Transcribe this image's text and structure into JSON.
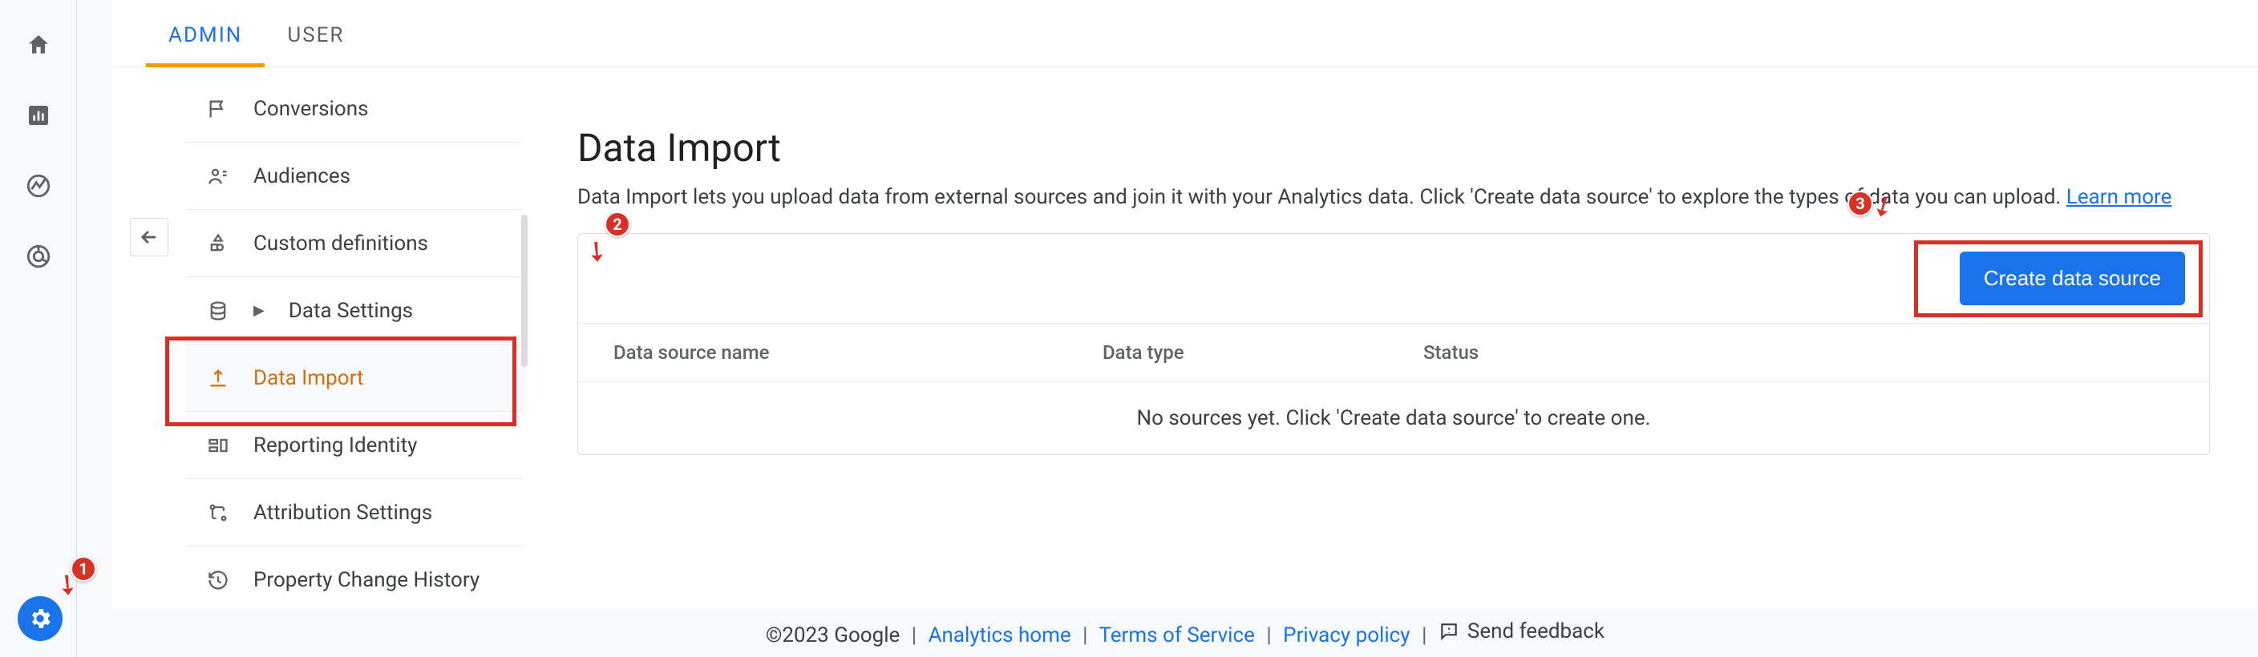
{
  "tabs": {
    "admin": "ADMIN",
    "user": "USER"
  },
  "nav": {
    "conversions": "Conversions",
    "audiences": "Audiences",
    "custom_defs": "Custom definitions",
    "data_settings": "Data Settings",
    "data_import": "Data Import",
    "reporting_identity": "Reporting Identity",
    "attribution": "Attribution Settings",
    "history": "Property Change History"
  },
  "page": {
    "title": "Data Import",
    "desc": "Data Import lets you upload data from external sources and join it with your Analytics data. Click 'Create data source' to explore the types of data you can upload.",
    "learn_more": "Learn more",
    "create_label": "Create data source",
    "th_name": "Data source name",
    "th_type": "Data type",
    "th_status": "Status",
    "empty": "No sources yet. Click 'Create data source' to create one."
  },
  "footer": {
    "copyright": "©2023 Google",
    "home": "Analytics home",
    "tos": "Terms of Service",
    "privacy": "Privacy policy",
    "feedback": "Send feedback"
  },
  "anno": {
    "a1": "1",
    "a2": "2",
    "a3": "3"
  }
}
